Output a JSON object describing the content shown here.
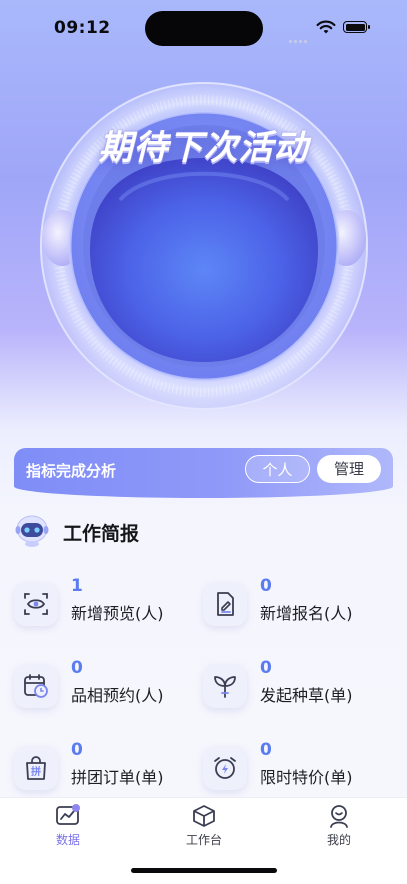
{
  "status_bar": {
    "time": "09:12"
  },
  "hero": {
    "title": "期待下次活动"
  },
  "metrics": {
    "title": "指标完成分析",
    "tabs": [
      {
        "label": "个人",
        "selected": true
      },
      {
        "label": "管理",
        "selected": false
      }
    ]
  },
  "work_report": {
    "title": "工作简报",
    "stats": [
      {
        "value": "1",
        "label": "新增预览(人)",
        "icon": "eye-scan-icon"
      },
      {
        "value": "0",
        "label": "新增报名(人)",
        "icon": "edit-document-icon"
      },
      {
        "value": "0",
        "label": "品相预约(人)",
        "icon": "calendar-clock-icon"
      },
      {
        "value": "0",
        "label": "发起种草(单)",
        "icon": "sprout-icon"
      },
      {
        "value": "0",
        "label": "拼团订单(单)",
        "icon": "group-bag-icon"
      },
      {
        "value": "0",
        "label": "限时特价(单)",
        "icon": "alarm-flash-icon"
      }
    ],
    "group_bag_glyph": "拼"
  },
  "tabbar": {
    "items": [
      {
        "label": "数据",
        "icon": "chart-icon",
        "active": true
      },
      {
        "label": "工作台",
        "icon": "cube-icon",
        "active": false
      },
      {
        "label": "我的",
        "icon": "profile-icon",
        "active": false
      }
    ]
  },
  "colors": {
    "accent": "#5b7cf0",
    "tab_active": "#7b72ea",
    "banner": "#8f99f8"
  }
}
